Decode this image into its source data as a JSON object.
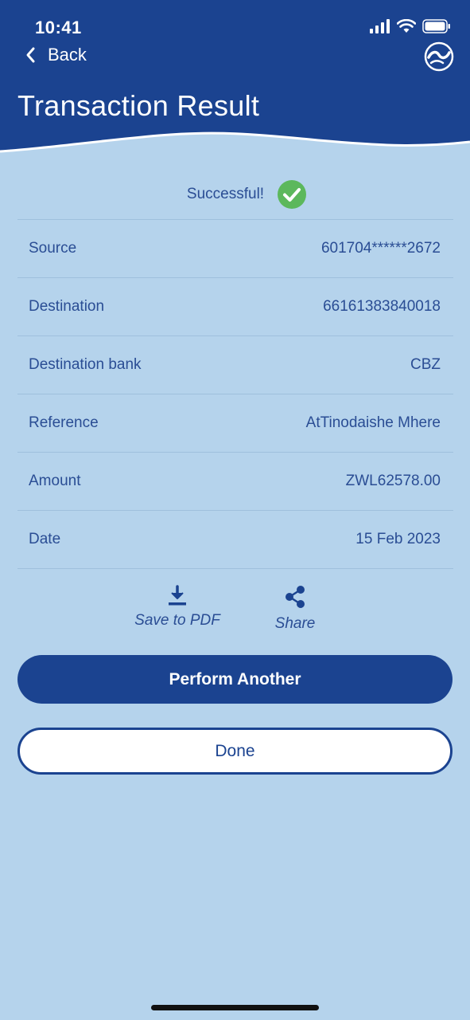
{
  "status_bar": {
    "time": "10:41"
  },
  "header": {
    "back_label": "Back",
    "title": "Transaction Result",
    "logo_icon": "bank-logo-icon"
  },
  "result": {
    "status_text": "Successful!",
    "status_icon": "check-circle-icon",
    "status_color": "#5cb85c"
  },
  "details": [
    {
      "label": "Source",
      "value": "601704******2672"
    },
    {
      "label": "Destination",
      "value": "66161383840018"
    },
    {
      "label": "Destination bank",
      "value": "CBZ"
    },
    {
      "label": "Reference",
      "value": "AtTinodaishe Mhere"
    },
    {
      "label": "Amount",
      "value": "ZWL62578.00"
    },
    {
      "label": "Date",
      "value": "15 Feb 2023"
    }
  ],
  "actions": {
    "save_pdf_label": "Save to PDF",
    "share_label": "Share"
  },
  "buttons": {
    "perform_another": "Perform Another",
    "done": "Done"
  },
  "colors": {
    "primary": "#1b4390",
    "background": "#b5d3ec",
    "text": "#2a4d94"
  }
}
